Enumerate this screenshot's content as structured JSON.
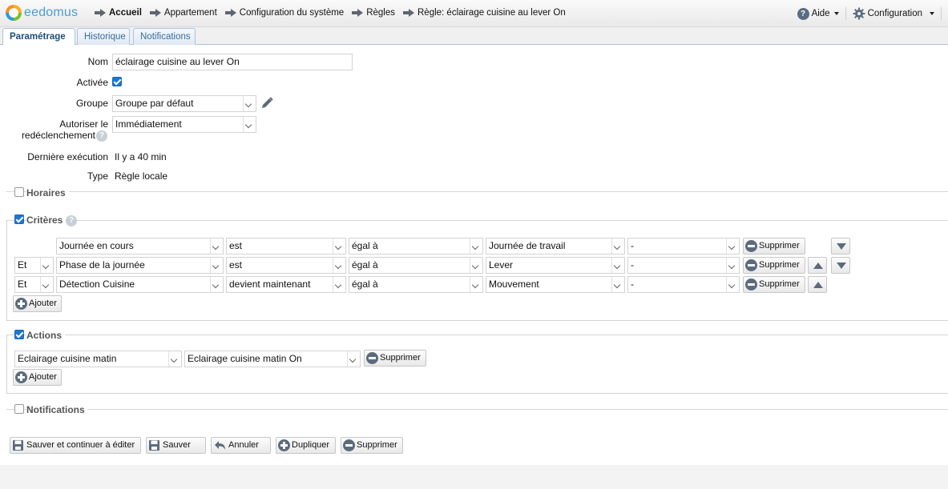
{
  "app": {
    "logo_text": "eedomus"
  },
  "breadcrumb": [
    "Accueil",
    "Appartement",
    "Configuration du système",
    "Règles",
    "Règle: éclairage cuisine au lever On"
  ],
  "header": {
    "help_label": "Aide",
    "config_label": "Configuration"
  },
  "tabs": [
    "Paramétrage",
    "Historique",
    "Notifications"
  ],
  "form": {
    "name_label": "Nom",
    "name_value": "éclairage cuisine au lever On",
    "active_label": "Activée",
    "active_checked": true,
    "group_label": "Groupe",
    "group_value": "Groupe par défaut",
    "retrigger_label_line1": "Autoriser le",
    "retrigger_label_line2": "redéclenchement",
    "retrigger_value": "Immédiatement",
    "last_exec_label": "Dernière exécution",
    "last_exec_value": "Il y a 40 min",
    "type_label": "Type",
    "type_value": "Règle locale"
  },
  "horaires": {
    "title": "Horaires",
    "checked": false
  },
  "criteres": {
    "title": "Critères",
    "checked": true,
    "rows": [
      {
        "conj": "",
        "device": "Journée en cours",
        "cond": "est",
        "op": "égal à",
        "value": "Journée de travail",
        "extra": "-"
      },
      {
        "conj": "Et",
        "device": "Phase de la journée",
        "cond": "est",
        "op": "égal à",
        "value": "Lever",
        "extra": "-"
      },
      {
        "conj": "Et",
        "device": "Détection Cuisine",
        "cond": "devient maintenant",
        "op": "égal à",
        "value": "Mouvement",
        "extra": "-"
      }
    ],
    "delete_label": "Supprimer",
    "add_label": "Ajouter"
  },
  "actions": {
    "title": "Actions",
    "checked": true,
    "rows": [
      {
        "device": "Eclairage cuisine matin",
        "value": "Eclairage cuisine matin On"
      }
    ],
    "delete_label": "Supprimer",
    "add_label": "Ajouter"
  },
  "notifications": {
    "title": "Notifications",
    "checked": false
  },
  "footer": {
    "save_continue": "Sauver et continuer à éditer",
    "save": "Sauver",
    "cancel": "Annuler",
    "duplicate": "Dupliquer",
    "delete": "Supprimer"
  },
  "colors": {
    "accent": "#1e77d2",
    "tab_text": "#3d6d9a",
    "icon": "#5c6b7c"
  }
}
